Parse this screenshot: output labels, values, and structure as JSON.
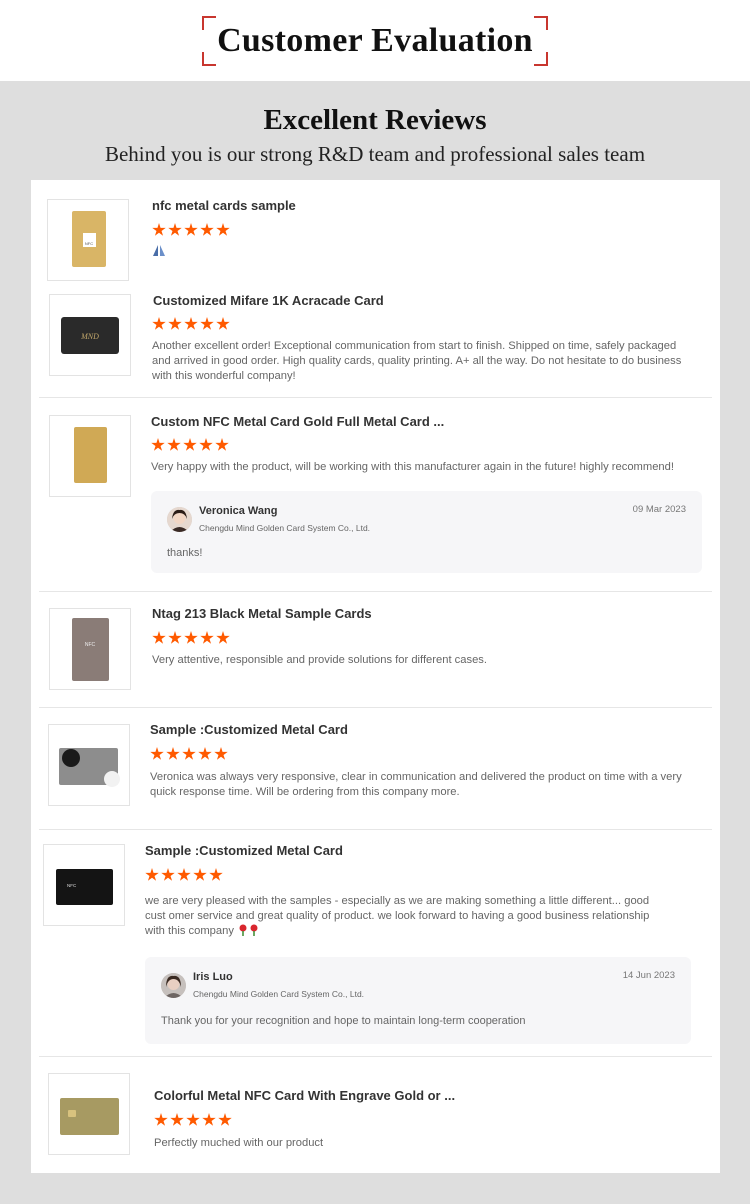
{
  "header": {
    "title": "Customer Evaluation"
  },
  "section": {
    "title": "Excellent Reviews",
    "subtitle": "Behind you is our strong R&D team and professional sales team"
  },
  "colors": {
    "star": "#ff5a00",
    "accent_corner": "#c8362f"
  },
  "reviews": [
    {
      "product": "nfc metal cards sample",
      "rating": 5,
      "comment": "",
      "comment_icon": "folded-hands-emoji",
      "thumb_label": "NFC"
    },
    {
      "product": "Customized Mifare 1K Acracade Card",
      "rating": 5,
      "comment": "Another excellent order! Exceptional communication from start to finish. Shipped on time, safely packaged and arrived in good order. High quality cards, quality printing. A+ all the way. Do not hesitate to do business with this wonderful company!",
      "thumb_label": "MND"
    },
    {
      "product": "Custom NFC Metal Card Gold Full Metal Card ...",
      "rating": 5,
      "comment": "Very happy with the product, will be working with this manufacturer again in the future! highly recommend!",
      "reply": {
        "name": "Veronica Wang",
        "company": "Chengdu Mind Golden Card System Co., Ltd.",
        "date": "09 Mar 2023",
        "text": "thanks!"
      }
    },
    {
      "product": "Ntag 213 Black Metal Sample Cards",
      "rating": 5,
      "comment": "Very attentive, responsible and provide solutions for different cases.",
      "thumb_label": "NFC"
    },
    {
      "product": "Sample :Customized Metal Card",
      "rating": 5,
      "comment": "Veronica was always very responsive, clear in communication and delivered the product on time with a very quick response time. Will be ordering from this company more."
    },
    {
      "product": "Sample :Customized Metal Card",
      "rating": 5,
      "comment": "we are very pleased with the samples - especially as we are making something a little different... good cust omer service and great quality of product. we look forward to having a good business relationship with this company",
      "comment_icon": "rose-emoji",
      "thumb_label": "NFC",
      "reply": {
        "name": "Iris Luo",
        "company": "Chengdu Mind Golden Card System Co., Ltd.",
        "date": "14 Jun 2023",
        "text": "Thank you for your recognition and hope to maintain long-term cooperation"
      }
    },
    {
      "product": "Colorful Metal NFC Card With Engrave Gold or ...",
      "rating": 5,
      "comment": "Perfectly muched with our product"
    }
  ]
}
